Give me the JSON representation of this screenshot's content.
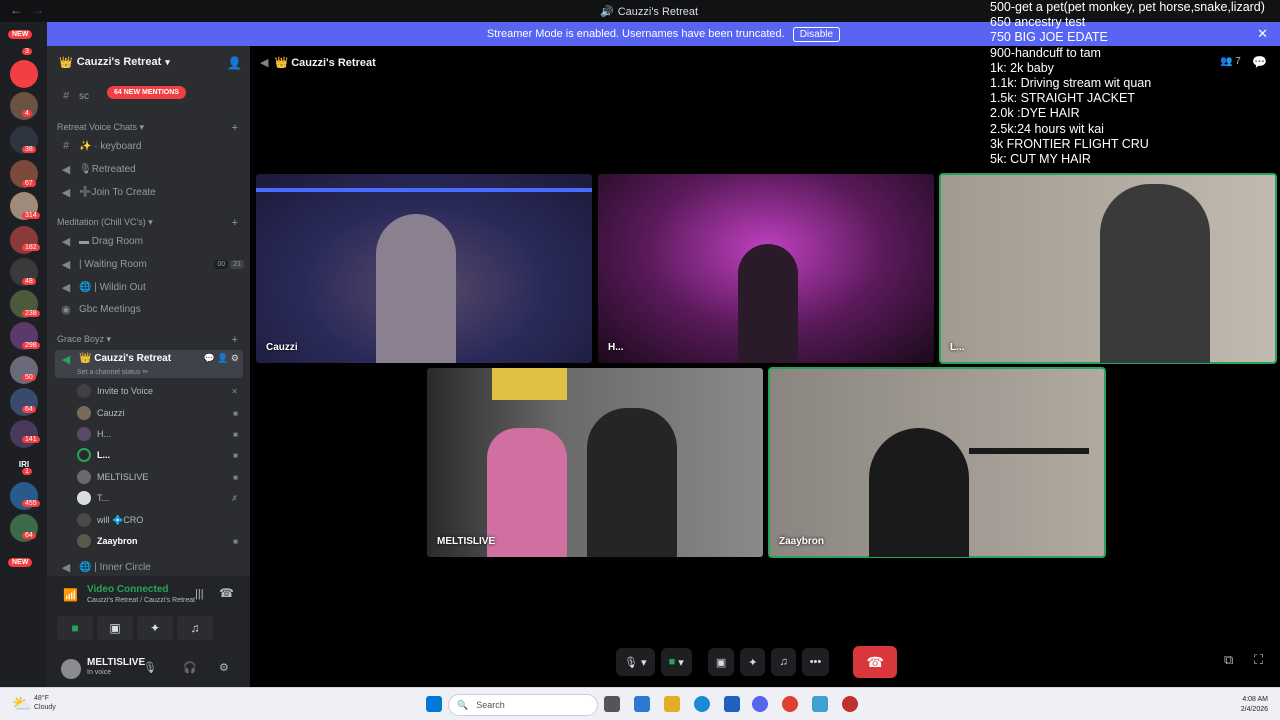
{
  "titlebar": {
    "title": "Cauzzi's Retreat",
    "back": "←",
    "forward": "→"
  },
  "banner": {
    "text": "Streamer Mode is enabled. Usernames have been truncated.",
    "disable_label": "Disable",
    "close": "✕"
  },
  "guild_badges": [
    "NEW",
    "3",
    "4",
    "38",
    "67",
    "314",
    "182",
    "48",
    "238",
    "298",
    "50",
    "64",
    "141",
    "IRI",
    "1",
    "455",
    "64",
    "NEW"
  ],
  "sidebar": {
    "server_name": "Cauzzi's Retreat",
    "mentions": "64 NEW MENTIONS",
    "top_channel": "sc",
    "categories": {
      "voice_chats": "Retreat Voice Chats",
      "meditation": "Meditation (Chill VC's)",
      "grace": "Grace Boyz"
    },
    "channels": {
      "keyboard": "✨ · keyboard",
      "retreated": "🎙Retreated",
      "join": "➕Join To Create",
      "drag_room": "▬ Drag Room",
      "waiting_room": "| Waiting Room",
      "waiting_count_a": "00",
      "waiting_count_b": "21",
      "wildin_out": "🌐 | Wildin Out",
      "gbc": "Gbc Meetings",
      "cauzzis_retreat": "👑 Cauzzi's Retreat",
      "channel_status": "Set a channel status ✏",
      "inner_circle": "🌐 | Inner Circle"
    },
    "voice_users": {
      "invite": "Invite to Voice",
      "u1": "Cauzzi",
      "u2": "H...",
      "u3": "L...",
      "u4": "MELTISLIVE",
      "u5": "T...",
      "u6": "will 💠CRO",
      "u7": "Zaaybron"
    },
    "voice_status": {
      "title": "Video Connected",
      "subtitle": "Cauzzi's Retreat / Cauzzi's Retreat"
    },
    "user_panel": {
      "name": "MELTISLIVE",
      "status": "In voice"
    }
  },
  "stage": {
    "channel_name": "👑 Cauzzi's Retreat",
    "member_count": "7",
    "tiles": {
      "t1": "Cauzzi",
      "t2": "H...",
      "t3": "L...",
      "t4": "MELTISLIVE",
      "t5": "Zaaybron"
    }
  },
  "overlay": {
    "lines": [
      "500-get a pet(pet monkey, pet horse,snake,lizard)",
      "650 ancestry test",
      "750 BIG JOE EDATE",
      "900-handcuff to tam",
      "1k: 2k baby",
      "1.1k: Driving stream wit quan",
      "1.5k: STRAIGHT JACKET",
      "2.0k :DYE HAIR",
      "2.5k:24 hours wit kai",
      "3k FRONTIER FLIGHT CRU",
      "5k: CUT MY HAIR"
    ]
  },
  "taskbar": {
    "weather_temp": "48°F",
    "weather_desc": "Cloudy",
    "search_placeholder": "Search",
    "time": "4:08 AM",
    "date": "2/4/2026"
  },
  "colors": {
    "accent": "#5865f2",
    "speaking": "#23a55a",
    "danger": "#da373c"
  }
}
